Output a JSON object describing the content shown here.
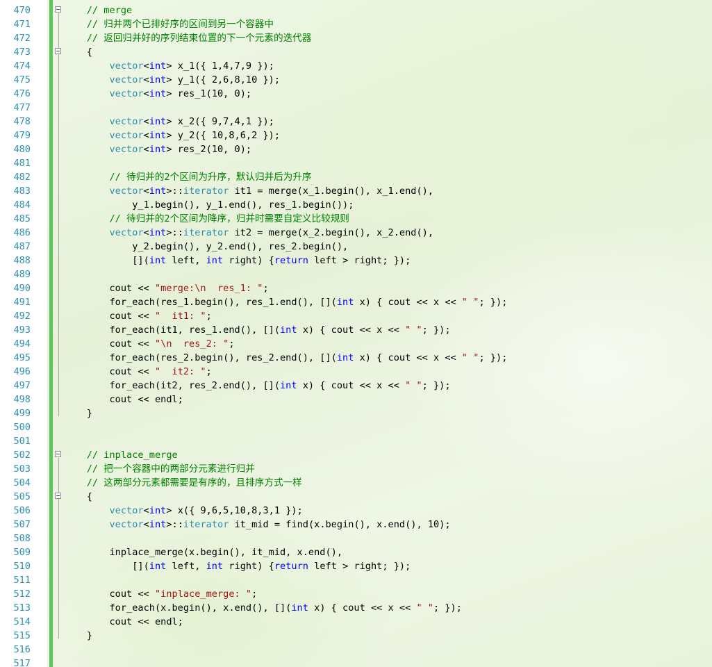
{
  "editor": {
    "colors": {
      "comment": "#008000",
      "keyword": "#0000ff",
      "type": "#2b91af",
      "string": "#a31515",
      "line_number": "#2b91af",
      "change_bar": "#5fc35f"
    },
    "lines": [
      {
        "n": "470",
        "fold": true,
        "tokens": [
          [
            "plain",
            "    "
          ],
          [
            "comment",
            "// merge"
          ]
        ]
      },
      {
        "n": "471",
        "fold": false,
        "tokens": [
          [
            "plain",
            "    "
          ],
          [
            "comment",
            "// 归并两个已排好序的区间到另一个容器中"
          ]
        ]
      },
      {
        "n": "472",
        "fold": false,
        "tokens": [
          [
            "plain",
            "    "
          ],
          [
            "comment",
            "// 返回归并好的序列结束位置的下一个元素的迭代器"
          ]
        ]
      },
      {
        "n": "473",
        "fold": true,
        "tokens": [
          [
            "plain",
            "    {"
          ]
        ]
      },
      {
        "n": "474",
        "fold": false,
        "tokens": [
          [
            "plain",
            "        "
          ],
          [
            "type",
            "vector"
          ],
          [
            "plain",
            "<"
          ],
          [
            "keyword",
            "int"
          ],
          [
            "plain",
            "> x_1({ 1,4,7,9 });"
          ]
        ]
      },
      {
        "n": "475",
        "fold": false,
        "tokens": [
          [
            "plain",
            "        "
          ],
          [
            "type",
            "vector"
          ],
          [
            "plain",
            "<"
          ],
          [
            "keyword",
            "int"
          ],
          [
            "plain",
            "> y_1({ 2,6,8,10 });"
          ]
        ]
      },
      {
        "n": "476",
        "fold": false,
        "tokens": [
          [
            "plain",
            "        "
          ],
          [
            "type",
            "vector"
          ],
          [
            "plain",
            "<"
          ],
          [
            "keyword",
            "int"
          ],
          [
            "plain",
            "> res_1(10, 0);"
          ]
        ]
      },
      {
        "n": "477",
        "fold": false,
        "tokens": [
          [
            "plain",
            ""
          ]
        ]
      },
      {
        "n": "478",
        "fold": false,
        "tokens": [
          [
            "plain",
            "        "
          ],
          [
            "type",
            "vector"
          ],
          [
            "plain",
            "<"
          ],
          [
            "keyword",
            "int"
          ],
          [
            "plain",
            "> x_2({ 9,7,4,1 });"
          ]
        ]
      },
      {
        "n": "479",
        "fold": false,
        "tokens": [
          [
            "plain",
            "        "
          ],
          [
            "type",
            "vector"
          ],
          [
            "plain",
            "<"
          ],
          [
            "keyword",
            "int"
          ],
          [
            "plain",
            "> y_2({ 10,8,6,2 });"
          ]
        ]
      },
      {
        "n": "480",
        "fold": false,
        "tokens": [
          [
            "plain",
            "        "
          ],
          [
            "type",
            "vector"
          ],
          [
            "plain",
            "<"
          ],
          [
            "keyword",
            "int"
          ],
          [
            "plain",
            "> res_2(10, 0);"
          ]
        ]
      },
      {
        "n": "481",
        "fold": false,
        "tokens": [
          [
            "plain",
            ""
          ]
        ]
      },
      {
        "n": "482",
        "fold": false,
        "tokens": [
          [
            "plain",
            "        "
          ],
          [
            "comment",
            "// 待归并的2个区间为升序，默认归并后为升序"
          ]
        ]
      },
      {
        "n": "483",
        "fold": false,
        "tokens": [
          [
            "plain",
            "        "
          ],
          [
            "type",
            "vector"
          ],
          [
            "plain",
            "<"
          ],
          [
            "keyword",
            "int"
          ],
          [
            "plain",
            ">::"
          ],
          [
            "type",
            "iterator"
          ],
          [
            "plain",
            " it1 = merge(x_1.begin(), x_1.end(),"
          ]
        ]
      },
      {
        "n": "484",
        "fold": false,
        "tokens": [
          [
            "plain",
            "            y_1.begin(), y_1.end(), res_1.begin());"
          ]
        ]
      },
      {
        "n": "485",
        "fold": false,
        "tokens": [
          [
            "plain",
            "        "
          ],
          [
            "comment",
            "// 待归并的2个区间为降序，归并时需要自定义比较规则"
          ]
        ]
      },
      {
        "n": "486",
        "fold": false,
        "tokens": [
          [
            "plain",
            "        "
          ],
          [
            "type",
            "vector"
          ],
          [
            "plain",
            "<"
          ],
          [
            "keyword",
            "int"
          ],
          [
            "plain",
            ">::"
          ],
          [
            "type",
            "iterator"
          ],
          [
            "plain",
            " it2 = merge(x_2.begin(), x_2.end(),"
          ]
        ]
      },
      {
        "n": "487",
        "fold": false,
        "tokens": [
          [
            "plain",
            "            y_2.begin(), y_2.end(), res_2.begin(),"
          ]
        ]
      },
      {
        "n": "488",
        "fold": false,
        "tokens": [
          [
            "plain",
            "            []("
          ],
          [
            "keyword",
            "int"
          ],
          [
            "plain",
            " left, "
          ],
          [
            "keyword",
            "int"
          ],
          [
            "plain",
            " right) {"
          ],
          [
            "keyword",
            "return"
          ],
          [
            "plain",
            " left > right; });"
          ]
        ]
      },
      {
        "n": "489",
        "fold": false,
        "tokens": [
          [
            "plain",
            ""
          ]
        ]
      },
      {
        "n": "490",
        "fold": false,
        "tokens": [
          [
            "plain",
            "        cout << "
          ],
          [
            "string",
            "\"merge:\\n  res_1: \""
          ],
          [
            "plain",
            ";"
          ]
        ]
      },
      {
        "n": "491",
        "fold": false,
        "tokens": [
          [
            "plain",
            "        for_each(res_1.begin(), res_1.end(), []("
          ],
          [
            "keyword",
            "int"
          ],
          [
            "plain",
            " x) { cout << x << "
          ],
          [
            "string",
            "\" \""
          ],
          [
            "plain",
            "; });"
          ]
        ]
      },
      {
        "n": "492",
        "fold": false,
        "tokens": [
          [
            "plain",
            "        cout << "
          ],
          [
            "string",
            "\"  it1: \""
          ],
          [
            "plain",
            ";"
          ]
        ]
      },
      {
        "n": "493",
        "fold": false,
        "tokens": [
          [
            "plain",
            "        for_each(it1, res_1.end(), []("
          ],
          [
            "keyword",
            "int"
          ],
          [
            "plain",
            " x) { cout << x << "
          ],
          [
            "string",
            "\" \""
          ],
          [
            "plain",
            "; });"
          ]
        ]
      },
      {
        "n": "494",
        "fold": false,
        "tokens": [
          [
            "plain",
            "        cout << "
          ],
          [
            "string",
            "\"\\n  res_2: \""
          ],
          [
            "plain",
            ";"
          ]
        ]
      },
      {
        "n": "495",
        "fold": false,
        "tokens": [
          [
            "plain",
            "        for_each(res_2.begin(), res_2.end(), []("
          ],
          [
            "keyword",
            "int"
          ],
          [
            "plain",
            " x) { cout << x << "
          ],
          [
            "string",
            "\" \""
          ],
          [
            "plain",
            "; });"
          ]
        ]
      },
      {
        "n": "496",
        "fold": false,
        "tokens": [
          [
            "plain",
            "        cout << "
          ],
          [
            "string",
            "\"  it2: \""
          ],
          [
            "plain",
            ";"
          ]
        ]
      },
      {
        "n": "497",
        "fold": false,
        "tokens": [
          [
            "plain",
            "        for_each(it2, res_2.end(), []("
          ],
          [
            "keyword",
            "int"
          ],
          [
            "plain",
            " x) { cout << x << "
          ],
          [
            "string",
            "\" \""
          ],
          [
            "plain",
            "; });"
          ]
        ]
      },
      {
        "n": "498",
        "fold": false,
        "tokens": [
          [
            "plain",
            "        cout << endl;"
          ]
        ]
      },
      {
        "n": "499",
        "fold": false,
        "tokens": [
          [
            "plain",
            "    }"
          ]
        ]
      },
      {
        "n": "500",
        "fold": false,
        "tokens": [
          [
            "plain",
            ""
          ]
        ]
      },
      {
        "n": "501",
        "fold": false,
        "tokens": [
          [
            "plain",
            ""
          ]
        ]
      },
      {
        "n": "502",
        "fold": true,
        "tokens": [
          [
            "plain",
            "    "
          ],
          [
            "comment",
            "// inplace_merge"
          ]
        ]
      },
      {
        "n": "503",
        "fold": false,
        "tokens": [
          [
            "plain",
            "    "
          ],
          [
            "comment",
            "// 把一个容器中的两部分元素进行归并"
          ]
        ]
      },
      {
        "n": "504",
        "fold": false,
        "tokens": [
          [
            "plain",
            "    "
          ],
          [
            "comment",
            "// 这两部分元素都需要是有序的，且排序方式一样"
          ]
        ]
      },
      {
        "n": "505",
        "fold": true,
        "tokens": [
          [
            "plain",
            "    {"
          ]
        ]
      },
      {
        "n": "506",
        "fold": false,
        "tokens": [
          [
            "plain",
            "        "
          ],
          [
            "type",
            "vector"
          ],
          [
            "plain",
            "<"
          ],
          [
            "keyword",
            "int"
          ],
          [
            "plain",
            "> x({ 9,6,5,10,8,3,1 });"
          ]
        ]
      },
      {
        "n": "507",
        "fold": false,
        "tokens": [
          [
            "plain",
            "        "
          ],
          [
            "type",
            "vector"
          ],
          [
            "plain",
            "<"
          ],
          [
            "keyword",
            "int"
          ],
          [
            "plain",
            ">::"
          ],
          [
            "type",
            "iterator"
          ],
          [
            "plain",
            " it_mid = find(x.begin(), x.end(), 10);"
          ]
        ]
      },
      {
        "n": "508",
        "fold": false,
        "tokens": [
          [
            "plain",
            ""
          ]
        ]
      },
      {
        "n": "509",
        "fold": false,
        "tokens": [
          [
            "plain",
            "        inplace_merge(x.begin(), it_mid, x.end(),"
          ]
        ]
      },
      {
        "n": "510",
        "fold": false,
        "tokens": [
          [
            "plain",
            "            []("
          ],
          [
            "keyword",
            "int"
          ],
          [
            "plain",
            " left, "
          ],
          [
            "keyword",
            "int"
          ],
          [
            "plain",
            " right) {"
          ],
          [
            "keyword",
            "return"
          ],
          [
            "plain",
            " left > right; });"
          ]
        ]
      },
      {
        "n": "511",
        "fold": false,
        "tokens": [
          [
            "plain",
            ""
          ]
        ]
      },
      {
        "n": "512",
        "fold": false,
        "tokens": [
          [
            "plain",
            "        cout << "
          ],
          [
            "string",
            "\"inplace_merge: \""
          ],
          [
            "plain",
            ";"
          ]
        ]
      },
      {
        "n": "513",
        "fold": false,
        "tokens": [
          [
            "plain",
            "        for_each(x.begin(), x.end(), []("
          ],
          [
            "keyword",
            "int"
          ],
          [
            "plain",
            " x) { cout << x << "
          ],
          [
            "string",
            "\" \""
          ],
          [
            "plain",
            "; });"
          ]
        ]
      },
      {
        "n": "514",
        "fold": false,
        "tokens": [
          [
            "plain",
            "        cout << endl;"
          ]
        ]
      },
      {
        "n": "515",
        "fold": false,
        "tokens": [
          [
            "plain",
            "    }"
          ]
        ]
      },
      {
        "n": "516",
        "fold": false,
        "tokens": [
          [
            "plain",
            ""
          ]
        ]
      },
      {
        "n": "517",
        "fold": false,
        "tokens": [
          [
            "plain",
            ""
          ]
        ]
      }
    ]
  }
}
